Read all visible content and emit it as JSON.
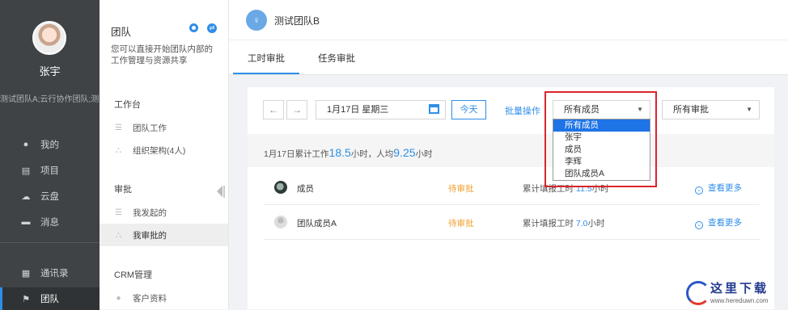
{
  "leftnav": {
    "user_name": "张宇",
    "user_teams": "测试团队A;云行协作团队;测试...",
    "items": [
      {
        "label": "我的",
        "icon": "person-icon"
      },
      {
        "label": "项目",
        "icon": "project-icon"
      },
      {
        "label": "云盘",
        "icon": "cloud-icon"
      },
      {
        "label": "消息",
        "icon": "message-icon"
      },
      {
        "label": "通讯录",
        "icon": "contacts-icon"
      },
      {
        "label": "团队",
        "icon": "flag-icon"
      }
    ]
  },
  "panel": {
    "title": "团队",
    "description": "您可以直接开始团队内部的工作管理与资源共享",
    "sections": {
      "workbench": "工作台",
      "approval": "审批",
      "crm": "CRM管理"
    },
    "items": {
      "team_work": "团队工作",
      "org": "组织架构(4人)",
      "initiated": "我发起的",
      "my_approvals": "我审批的",
      "customers": "客户资料"
    }
  },
  "header": {
    "team_name": "测试团队B",
    "tabs": [
      "工时审批",
      "任务审批"
    ]
  },
  "toolbar": {
    "date": "1月17日  星期三",
    "today": "今天",
    "batch": "批量操作",
    "member_select": "所有成员",
    "approval_select": "所有审批",
    "dropdown_options": [
      "所有成员",
      "张宇",
      "成员",
      "李辉",
      "团队成员A"
    ]
  },
  "summary": {
    "prefix": "1月17日累计工作",
    "total": "18.5",
    "mid": "小时，人均",
    "avg": "9.25",
    "suffix": "小时"
  },
  "rows": [
    {
      "name": "成员",
      "status": "待审批",
      "hours_label": "累计填报工时",
      "hours": "11.5",
      "unit": "小时",
      "more": "查看更多"
    },
    {
      "name": "团队成员A",
      "status": "待审批",
      "hours_label": "累计填报工时",
      "hours": "7.0",
      "unit": "小时",
      "more": "查看更多"
    }
  ],
  "watermark": {
    "text": "这里下载",
    "url": "www.hereduwn.com"
  }
}
